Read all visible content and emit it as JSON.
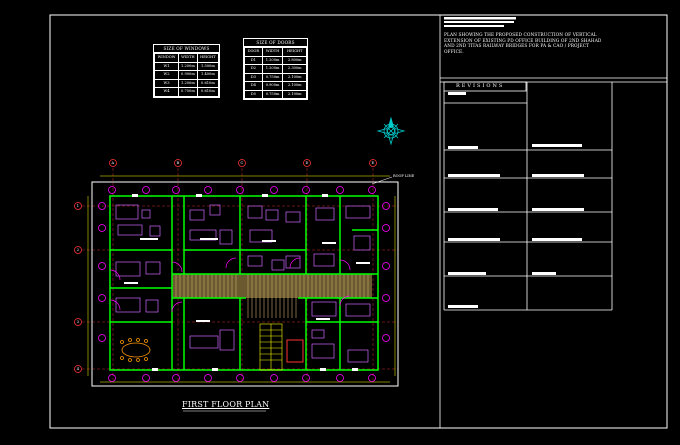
{
  "title_block": {
    "heading_lines": [
      "PLAN SHOWING THE PROPOSED CONSTRUCTION OF VERTICAL",
      "EXTENSION OF EXISTING PD OFFICE BUILDING OF 2ND SHAHAD",
      "AND 2ND TITAS RAILWAY BRIDGES FOR PA & CAO / PROJECT",
      "OFFICE."
    ],
    "revisions_label": "REVISIONS"
  },
  "windows_table": {
    "title": "SIZE OF WINDOWS",
    "headers": [
      "WINDOW",
      "WIDTH",
      "HEIGHT"
    ],
    "rows": [
      [
        "W1",
        "1.200m",
        "1.500m"
      ],
      [
        "W2",
        "0.900m",
        "1.400m"
      ],
      [
        "W3",
        "1.200m",
        "0.610m"
      ],
      [
        "W4",
        "0.750m",
        "0.610m"
      ]
    ]
  },
  "doors_table": {
    "title": "SIZE OF DOORS",
    "headers": [
      "DOOR",
      "WIDTH",
      "HEIGHT"
    ],
    "rows": [
      [
        "D1",
        "1.200m",
        "2.800m"
      ],
      [
        "D2",
        "1.200m",
        "2.300m"
      ],
      [
        "D3",
        "0.750m",
        "2.100m"
      ],
      [
        "D4",
        "0.900m",
        "2.100m"
      ],
      [
        "D5",
        "0.750m",
        "2.100m"
      ]
    ]
  },
  "plan": {
    "title": "FIRST FLOOR PLAN",
    "roof_line_label": "ROOF LINE",
    "grid_columns": [
      "A",
      "B",
      "C",
      "D",
      "E"
    ],
    "grid_rows": [
      "1",
      "2",
      "3",
      "4"
    ]
  },
  "colors": {
    "background": "#000000",
    "wall": "#00ff00",
    "furniture": "#ff66ff",
    "door": "#ff00ff",
    "dimension": "#ffff00",
    "grid": "#ff3333",
    "stair": "#ffff00",
    "compass": "#00cccc",
    "corridor": "#b8a06a",
    "lines": "#ffffff"
  }
}
